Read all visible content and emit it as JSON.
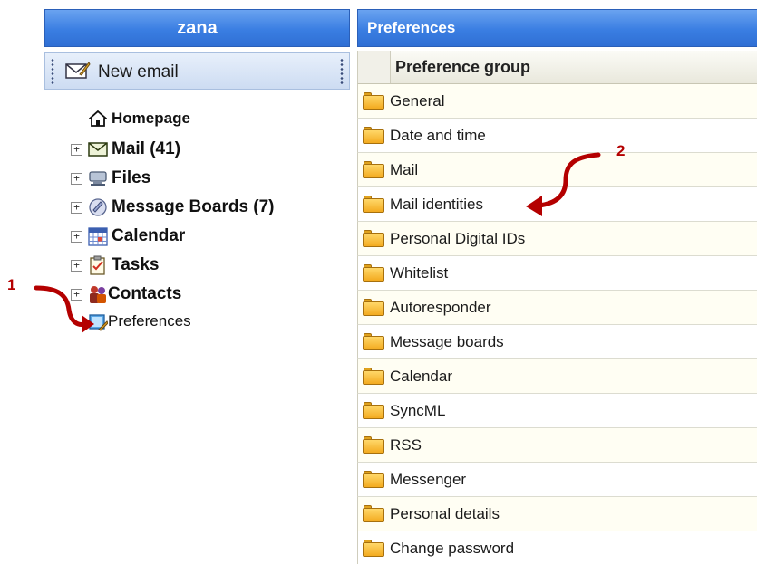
{
  "left": {
    "user": "zana",
    "new_email": "New email",
    "tree": [
      {
        "label": "Homepage",
        "icon": "home-icon",
        "expandable": false
      },
      {
        "label": "Mail (41)",
        "icon": "envelope-icon",
        "expandable": true
      },
      {
        "label": "Files",
        "icon": "files-icon",
        "expandable": true
      },
      {
        "label": "Message Boards (7)",
        "icon": "message-boards-icon",
        "expandable": true
      },
      {
        "label": "Calendar",
        "icon": "calendar-icon",
        "expandable": true
      },
      {
        "label": "Tasks",
        "icon": "tasks-icon",
        "expandable": true
      },
      {
        "label": "Contacts",
        "icon": "contacts-icon",
        "expandable": true
      },
      {
        "label": "Preferences",
        "icon": "preferences-icon",
        "expandable": false
      }
    ]
  },
  "right": {
    "title": "Preferences",
    "column_header": "Preference group",
    "groups": [
      "General",
      "Date and time",
      "Mail",
      "Mail identities",
      "Personal Digital IDs",
      "Whitelist",
      "Autoresponder",
      "Message boards",
      "Calendar",
      "SyncML",
      "RSS",
      "Messenger",
      "Personal details",
      "Change password"
    ]
  },
  "callouts": {
    "one": "1",
    "two": "2"
  },
  "colors": {
    "header_blue": "#3a7ee2",
    "callout_red": "#b40000",
    "folder_orange": "#f3aa1f"
  }
}
